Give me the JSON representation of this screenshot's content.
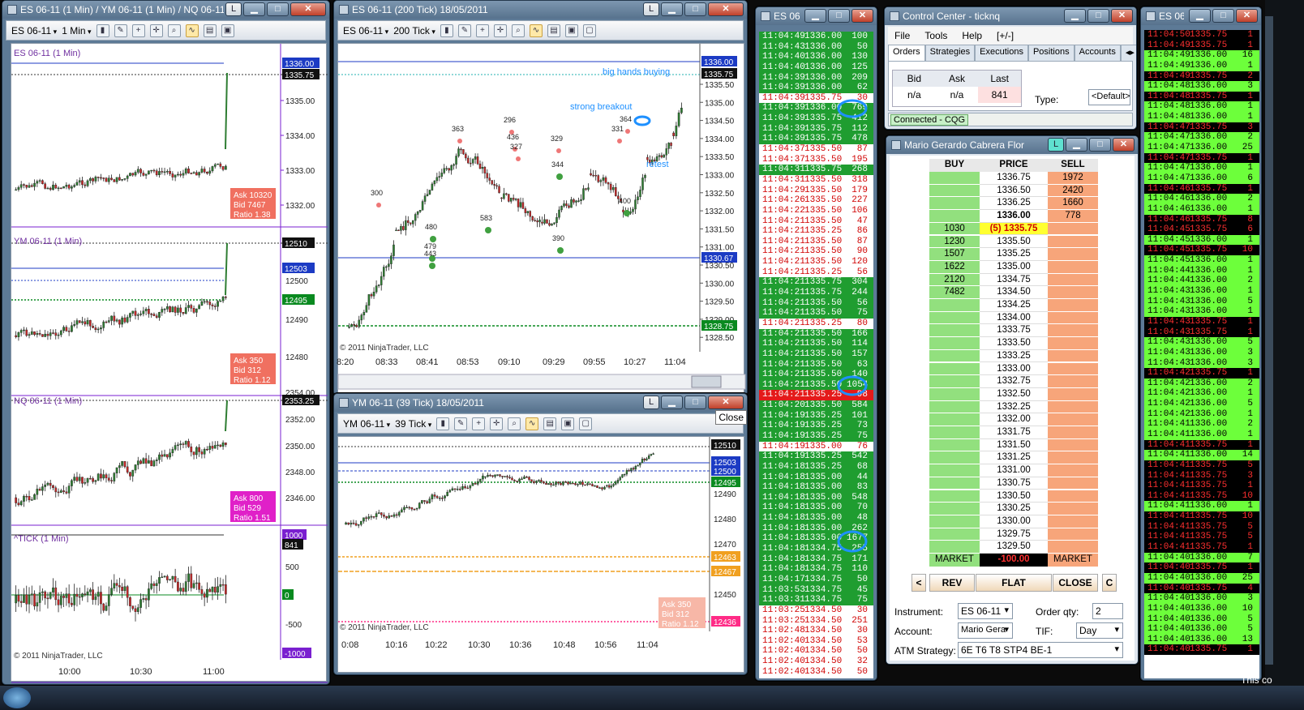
{
  "colors": {
    "up": "#2e7d32",
    "down": "#c62828",
    "green_band": "#1f9d30",
    "red_row": "#e41a1a",
    "tag_blue": "#1c3bc4",
    "tag_purple": "#7a1fd0",
    "tag_orange": "#f0a020",
    "tag_green": "#0a8a20",
    "tag_pink": "#ff2b86"
  },
  "win1": {
    "title": "ES 06-11 (1 Min) / YM 06-11 (1 Min) / NQ 06-11",
    "instrument": "ES 06-11",
    "interval": "1 Min",
    "copyright": "© 2011 NinjaTrader, LLC",
    "xticks": [
      "10:00",
      "10:30",
      "11:00"
    ],
    "panes": [
      {
        "label": "ES 06-11 (1 Min)",
        "yticks": [
          "1335.00",
          "1334.00",
          "1333.00",
          "1332.00"
        ],
        "tags": [
          "1336.00",
          "1335.75"
        ],
        "info": [
          "Ask 10320",
          "Bid 7467",
          "Ratio 1.38"
        ]
      },
      {
        "label": "YM 06-11 (1 Min)",
        "yticks": [
          "12500",
          "12490",
          "12480"
        ],
        "tags": [
          "12510",
          "12503",
          "12495"
        ],
        "info": [
          "Ask 350",
          "Bid 312",
          "Ratio 1.12"
        ]
      },
      {
        "label": "NQ 06-11 (1 Min)",
        "yticks": [
          "2354.00",
          "2352.00",
          "2350.00",
          "2348.00",
          "2346.00"
        ],
        "tags": [
          "2353.25"
        ],
        "info": [
          "Ask 800",
          "Bid 529",
          "Ratio 1.51"
        ]
      },
      {
        "label": "^TICK (1 Min)",
        "yticks": [
          "500",
          "-500"
        ],
        "tags": [
          "1000",
          "841",
          "0",
          "-1000"
        ]
      }
    ]
  },
  "win2": {
    "title": "ES 06-11 (200 Tick)  18/05/2011",
    "instrument": "ES 06-11",
    "interval": "200 Tick",
    "copyright": "© 2011 NinjaTrader, LLC",
    "yticks": [
      "1335.50",
      "1335.00",
      "1334.50",
      "1334.00",
      "1333.50",
      "1333.00",
      "1332.50",
      "1332.00",
      "1331.50",
      "1331.00",
      "1330.50",
      "1330.00",
      "1329.50",
      "1329.00",
      "1328.50"
    ],
    "xticks": [
      "8:20",
      "08:33",
      "08:41",
      "08:53",
      "09:10",
      "09:29",
      "09:55",
      "10:27",
      "11:04"
    ],
    "tags": [
      "1336.00",
      "1335.75",
      "1330.67",
      "1328.75"
    ],
    "annotations": [
      "big hands buying",
      "strong breakout",
      "retest"
    ],
    "numbers": [
      "363",
      "296",
      "436",
      "327",
      "329",
      "344",
      "331",
      "364",
      "300",
      "480",
      "479",
      "443",
      "583",
      "390",
      "400"
    ]
  },
  "win3": {
    "title": "YM 06-11 (39 Tick)  18/05/2011",
    "instrument": "YM 06-11",
    "interval": "39 Tick",
    "copyright": "© 2011 NinjaTrader, LLC",
    "yticks": [
      "12490",
      "12480",
      "12470",
      "12460",
      "12450",
      "12440"
    ],
    "xticks": [
      "0:08",
      "10:16",
      "10:22",
      "10:30",
      "10:36",
      "10:48",
      "10:56",
      "11:04"
    ],
    "tags": [
      "12510",
      "12503",
      "12500",
      "12495",
      "12463",
      "12467",
      "12436"
    ],
    "info": [
      "Ask 350",
      "Bid 312",
      "Ratio 1.12"
    ],
    "tooltip": "Close"
  },
  "ts1": {
    "title": "ES 06-11",
    "rows": [
      [
        "11:04:49",
        "1336.00",
        "100",
        "g"
      ],
      [
        "11:04:43",
        "1336.00",
        "50",
        "g"
      ],
      [
        "11:04:40",
        "1336.00",
        "130",
        "g"
      ],
      [
        "11:04:40",
        "1336.00",
        "125",
        "g"
      ],
      [
        "11:04:39",
        "1336.00",
        "209",
        "g"
      ],
      [
        "11:04:39",
        "1336.00",
        "62",
        "g"
      ],
      [
        "11:04:39",
        "1335.75",
        "30",
        "w"
      ],
      [
        "11:04:39",
        "1336.00",
        "769",
        "g"
      ],
      [
        "11:04:39",
        "1335.75",
        "412",
        "g"
      ],
      [
        "11:04:39",
        "1335.75",
        "112",
        "g"
      ],
      [
        "11:04:39",
        "1335.75",
        "478",
        "g"
      ],
      [
        "11:04:37",
        "1335.50",
        "87",
        "w"
      ],
      [
        "11:04:37",
        "1335.50",
        "195",
        "w"
      ],
      [
        "11:04:31",
        "1335.75",
        "268",
        "g"
      ],
      [
        "11:04:31",
        "1335.50",
        "318",
        "w"
      ],
      [
        "11:04:29",
        "1335.50",
        "179",
        "w"
      ],
      [
        "11:04:26",
        "1335.50",
        "227",
        "w"
      ],
      [
        "11:04:22",
        "1335.50",
        "106",
        "w"
      ],
      [
        "11:04:21",
        "1335.50",
        "47",
        "w"
      ],
      [
        "11:04:21",
        "1335.25",
        "86",
        "w"
      ],
      [
        "11:04:21",
        "1335.50",
        "87",
        "w"
      ],
      [
        "11:04:21",
        "1335.50",
        "90",
        "w"
      ],
      [
        "11:04:21",
        "1335.50",
        "120",
        "w"
      ],
      [
        "11:04:21",
        "1335.25",
        "56",
        "w"
      ],
      [
        "11:04:21",
        "1335.75",
        "304",
        "g"
      ],
      [
        "11:04:21",
        "1335.75",
        "244",
        "g"
      ],
      [
        "11:04:21",
        "1335.50",
        "56",
        "g"
      ],
      [
        "11:04:21",
        "1335.50",
        "75",
        "g"
      ],
      [
        "11:04:21",
        "1335.25",
        "80",
        "w"
      ],
      [
        "11:04:21",
        "1335.50",
        "166",
        "g"
      ],
      [
        "11:04:21",
        "1335.50",
        "114",
        "g"
      ],
      [
        "11:04:21",
        "1335.50",
        "157",
        "g"
      ],
      [
        "11:04:21",
        "1335.50",
        "63",
        "g"
      ],
      [
        "11:04:21",
        "1335.50",
        "140",
        "g"
      ],
      [
        "11:04:21",
        "1335.50",
        "1054",
        "g"
      ],
      [
        "11:04:21",
        "1335.25",
        "98",
        "r"
      ],
      [
        "11:04:20",
        "1335.50",
        "584",
        "g"
      ],
      [
        "11:04:19",
        "1335.25",
        "101",
        "g"
      ],
      [
        "11:04:19",
        "1335.25",
        "73",
        "g"
      ],
      [
        "11:04:19",
        "1335.25",
        "75",
        "g"
      ],
      [
        "11:04:19",
        "1335.00",
        "76",
        "w"
      ],
      [
        "11:04:19",
        "1335.25",
        "542",
        "g"
      ],
      [
        "11:04:18",
        "1335.25",
        "68",
        "g"
      ],
      [
        "11:04:18",
        "1335.00",
        "44",
        "g"
      ],
      [
        "11:04:18",
        "1335.00",
        "83",
        "g"
      ],
      [
        "11:04:18",
        "1335.00",
        "548",
        "g"
      ],
      [
        "11:04:18",
        "1335.00",
        "70",
        "g"
      ],
      [
        "11:04:18",
        "1335.00",
        "48",
        "g"
      ],
      [
        "11:04:18",
        "1335.00",
        "262",
        "g"
      ],
      [
        "11:04:18",
        "1335.00",
        "1677",
        "g"
      ],
      [
        "11:04:18",
        "1334.75",
        "255",
        "g"
      ],
      [
        "11:04:18",
        "1334.75",
        "171",
        "g"
      ],
      [
        "11:04:18",
        "1334.75",
        "110",
        "g"
      ],
      [
        "11:04:17",
        "1334.75",
        "50",
        "g"
      ],
      [
        "11:03:53",
        "1334.75",
        "45",
        "g"
      ],
      [
        "11:03:31",
        "1334.75",
        "75",
        "g"
      ],
      [
        "11:03:25",
        "1334.50",
        "30",
        "w"
      ],
      [
        "11:03:25",
        "1334.50",
        "251",
        "w"
      ],
      [
        "11:02:48",
        "1334.50",
        "30",
        "w"
      ],
      [
        "11:02:40",
        "1334.50",
        "53",
        "w"
      ],
      [
        "11:02:40",
        "1334.50",
        "50",
        "w"
      ],
      [
        "11:02:40",
        "1334.50",
        "32",
        "w"
      ],
      [
        "11:02:40",
        "1334.50",
        "50",
        "w"
      ]
    ]
  },
  "ts2": {
    "title": "ES 06-11",
    "rows": [
      [
        "11:04:50",
        "1335.75",
        "1",
        "r"
      ],
      [
        "11:04:49",
        "1335.75",
        "1",
        "r"
      ],
      [
        "11:04:49",
        "1336.00",
        "16",
        "g"
      ],
      [
        "11:04:49",
        "1336.00",
        "1",
        "g"
      ],
      [
        "11:04:49",
        "1335.75",
        "2",
        "r"
      ],
      [
        "11:04:48",
        "1336.00",
        "3",
        "g"
      ],
      [
        "11:04:48",
        "1335.75",
        "1",
        "r"
      ],
      [
        "11:04:48",
        "1336.00",
        "1",
        "g"
      ],
      [
        "11:04:48",
        "1336.00",
        "1",
        "g"
      ],
      [
        "11:04:47",
        "1335.75",
        "3",
        "r"
      ],
      [
        "11:04:47",
        "1336.00",
        "2",
        "g"
      ],
      [
        "11:04:47",
        "1336.00",
        "25",
        "g"
      ],
      [
        "11:04:47",
        "1335.75",
        "1",
        "r"
      ],
      [
        "11:04:47",
        "1336.00",
        "1",
        "g"
      ],
      [
        "11:04:47",
        "1336.00",
        "6",
        "g"
      ],
      [
        "11:04:46",
        "1335.75",
        "1",
        "r"
      ],
      [
        "11:04:46",
        "1336.00",
        "2",
        "g"
      ],
      [
        "11:04:46",
        "1336.00",
        "1",
        "g"
      ],
      [
        "11:04:46",
        "1335.75",
        "8",
        "r"
      ],
      [
        "11:04:45",
        "1335.75",
        "6",
        "r"
      ],
      [
        "11:04:45",
        "1336.00",
        "1",
        "g"
      ],
      [
        "11:04:45",
        "1335.75",
        "10",
        "r"
      ],
      [
        "11:04:45",
        "1336.00",
        "1",
        "g"
      ],
      [
        "11:04:44",
        "1336.00",
        "1",
        "g"
      ],
      [
        "11:04:44",
        "1336.00",
        "2",
        "g"
      ],
      [
        "11:04:43",
        "1336.00",
        "1",
        "g"
      ],
      [
        "11:04:43",
        "1336.00",
        "5",
        "g"
      ],
      [
        "11:04:43",
        "1336.00",
        "1",
        "g"
      ],
      [
        "11:04:43",
        "1335.75",
        "1",
        "r"
      ],
      [
        "11:04:43",
        "1335.75",
        "1",
        "r"
      ],
      [
        "11:04:43",
        "1336.00",
        "5",
        "g"
      ],
      [
        "11:04:43",
        "1336.00",
        "3",
        "g"
      ],
      [
        "11:04:43",
        "1336.00",
        "3",
        "g"
      ],
      [
        "11:04:42",
        "1335.75",
        "1",
        "r"
      ],
      [
        "11:04:42",
        "1336.00",
        "2",
        "g"
      ],
      [
        "11:04:42",
        "1336.00",
        "1",
        "g"
      ],
      [
        "11:04:42",
        "1336.00",
        "5",
        "g"
      ],
      [
        "11:04:42",
        "1336.00",
        "1",
        "g"
      ],
      [
        "11:04:41",
        "1336.00",
        "2",
        "g"
      ],
      [
        "11:04:41",
        "1336.00",
        "1",
        "g"
      ],
      [
        "11:04:41",
        "1335.75",
        "1",
        "r"
      ],
      [
        "11:04:41",
        "1336.00",
        "14",
        "g"
      ],
      [
        "11:04:41",
        "1335.75",
        "5",
        "r"
      ],
      [
        "11:04:41",
        "1335.75",
        "3",
        "r"
      ],
      [
        "11:04:41",
        "1335.75",
        "1",
        "r"
      ],
      [
        "11:04:41",
        "1335.75",
        "10",
        "r"
      ],
      [
        "11:04:41",
        "1336.00",
        "1",
        "g"
      ],
      [
        "11:04:41",
        "1335.75",
        "10",
        "r"
      ],
      [
        "11:04:41",
        "1335.75",
        "5",
        "r"
      ],
      [
        "11:04:41",
        "1335.75",
        "5",
        "r"
      ],
      [
        "11:04:41",
        "1335.75",
        "1",
        "r"
      ],
      [
        "11:04:40",
        "1336.00",
        "7",
        "g"
      ],
      [
        "11:04:40",
        "1335.75",
        "1",
        "r"
      ],
      [
        "11:04:40",
        "1336.00",
        "25",
        "g"
      ],
      [
        "11:04:40",
        "1335.75",
        "4",
        "r"
      ],
      [
        "11:04:40",
        "1336.00",
        "3",
        "g"
      ],
      [
        "11:04:40",
        "1336.00",
        "10",
        "g"
      ],
      [
        "11:04:40",
        "1336.00",
        "5",
        "g"
      ],
      [
        "11:04:40",
        "1336.00",
        "5",
        "g"
      ],
      [
        "11:04:40",
        "1336.00",
        "13",
        "g"
      ],
      [
        "11:04:40",
        "1335.75",
        "1",
        "r"
      ]
    ]
  },
  "cc": {
    "title": "Control Center - ticknq",
    "menu": [
      "File",
      "Tools",
      "Help",
      "[+/-]"
    ],
    "tabs": [
      "Orders",
      "Strategies",
      "Executions",
      "Positions",
      "Accounts"
    ],
    "quote_headers": [
      "Bid",
      "Ask",
      "Last"
    ],
    "quote_values": [
      "n/a",
      "n/a",
      "841"
    ],
    "type_label": "Type:",
    "type_value": "<Default>",
    "status": "Connected - CQG"
  },
  "dom": {
    "title": "Mario Gerardo Cabrera Flor",
    "headers": [
      "BUY",
      "PRICE",
      "SELL"
    ],
    "rows": [
      [
        "",
        "1336.75",
        "1972"
      ],
      [
        "",
        "1336.50",
        "2420"
      ],
      [
        "",
        "1336.25",
        "1660"
      ],
      [
        "",
        "1336.00",
        "778"
      ],
      [
        "1030",
        "(5) 1335.75",
        ""
      ],
      [
        "1230",
        "1335.50",
        ""
      ],
      [
        "1507",
        "1335.25",
        ""
      ],
      [
        "1622",
        "1335.00",
        ""
      ],
      [
        "2120",
        "1334.75",
        ""
      ],
      [
        "7482",
        "1334.50",
        ""
      ],
      [
        "",
        "1334.25",
        ""
      ],
      [
        "",
        "1334.00",
        ""
      ],
      [
        "",
        "1333.75",
        ""
      ],
      [
        "",
        "1333.50",
        ""
      ],
      [
        "",
        "1333.25",
        ""
      ],
      [
        "",
        "1333.00",
        ""
      ],
      [
        "",
        "1332.75",
        ""
      ],
      [
        "",
        "1332.50",
        ""
      ],
      [
        "",
        "1332.25",
        ""
      ],
      [
        "",
        "1332.00",
        ""
      ],
      [
        "",
        "1331.75",
        ""
      ],
      [
        "",
        "1331.50",
        ""
      ],
      [
        "",
        "1331.25",
        ""
      ],
      [
        "",
        "1331.00",
        ""
      ],
      [
        "",
        "1330.75",
        ""
      ],
      [
        "",
        "1330.50",
        ""
      ],
      [
        "",
        "1330.25",
        ""
      ],
      [
        "",
        "1330.00",
        ""
      ],
      [
        "",
        "1329.75",
        ""
      ],
      [
        "",
        "1329.50",
        ""
      ]
    ],
    "market_buy": "MARKET",
    "pnl": "-100.00",
    "market_sell": "MARKET",
    "buttons": [
      "<",
      "REV",
      "FLAT",
      "CLOSE",
      "C"
    ],
    "instrument_label": "Instrument:",
    "instrument": "ES 06-11",
    "orderqty_label": "Order qty:",
    "orderqty": "2",
    "account_label": "Account:",
    "account": "Mario Gera",
    "tif_label": "TIF:",
    "tif": "Day",
    "atm_label": "ATM Strategy:",
    "atm": "6E T6 T8 STP4 BE-1"
  },
  "taskbar_text": "This co"
}
